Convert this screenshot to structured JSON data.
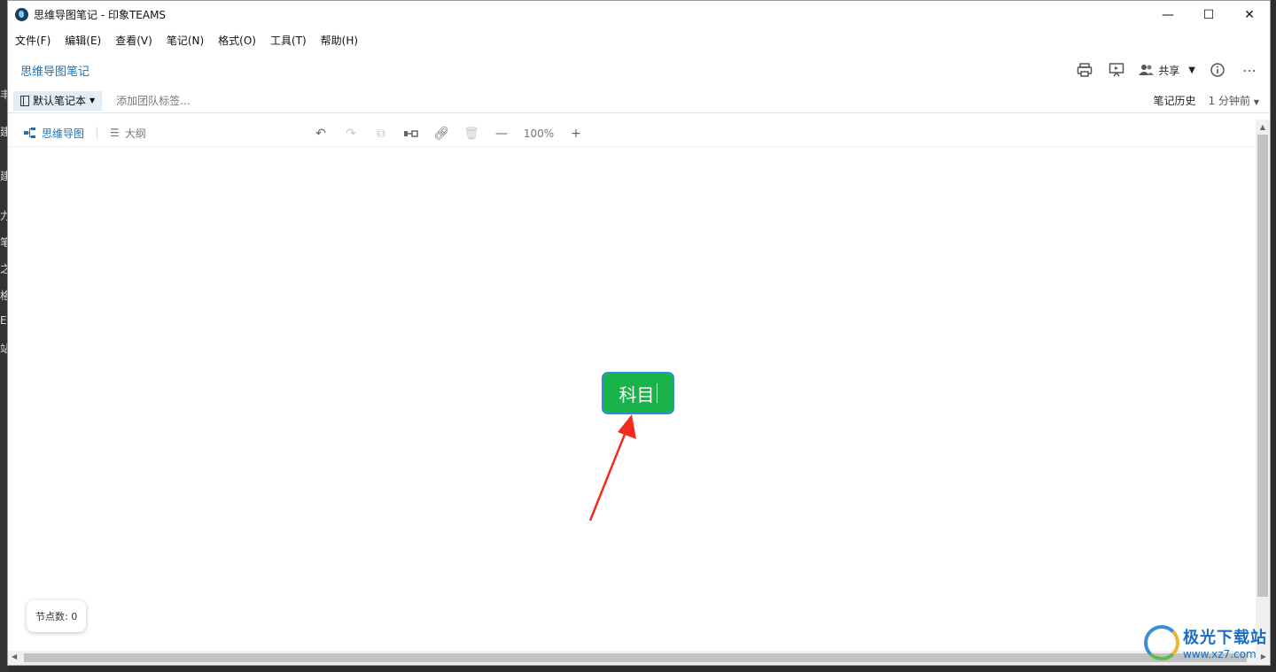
{
  "window": {
    "title": "思维导图笔记 - 印象TEAMS",
    "controls": [
      "—",
      "☐",
      "✕"
    ]
  },
  "menu": [
    "文件(F)",
    "编辑(E)",
    "查看(V)",
    "笔记(N)",
    "格式(O)",
    "工具(T)",
    "帮助(H)"
  ],
  "header": {
    "breadcrumb": "思维导图笔记",
    "share_label": "共享"
  },
  "tagbar": {
    "notebook": "默认笔记本",
    "add_tag_placeholder": "添加团队标签...",
    "history": "笔记历史",
    "last_edit": "1 分钟前"
  },
  "editor": {
    "view_mindmap": "思维导图",
    "view_outline": "大纲",
    "zoom": "100%"
  },
  "canvas": {
    "node_text": "科目",
    "node_count": "节点数: 0"
  },
  "watermark": {
    "title": "极光下载站",
    "url": "www.xz7.com"
  },
  "colors": {
    "node_fill": "#19b34a",
    "node_border": "#2b8fd6",
    "accent": "#1a73b8",
    "arrow": "#f22b1e"
  }
}
